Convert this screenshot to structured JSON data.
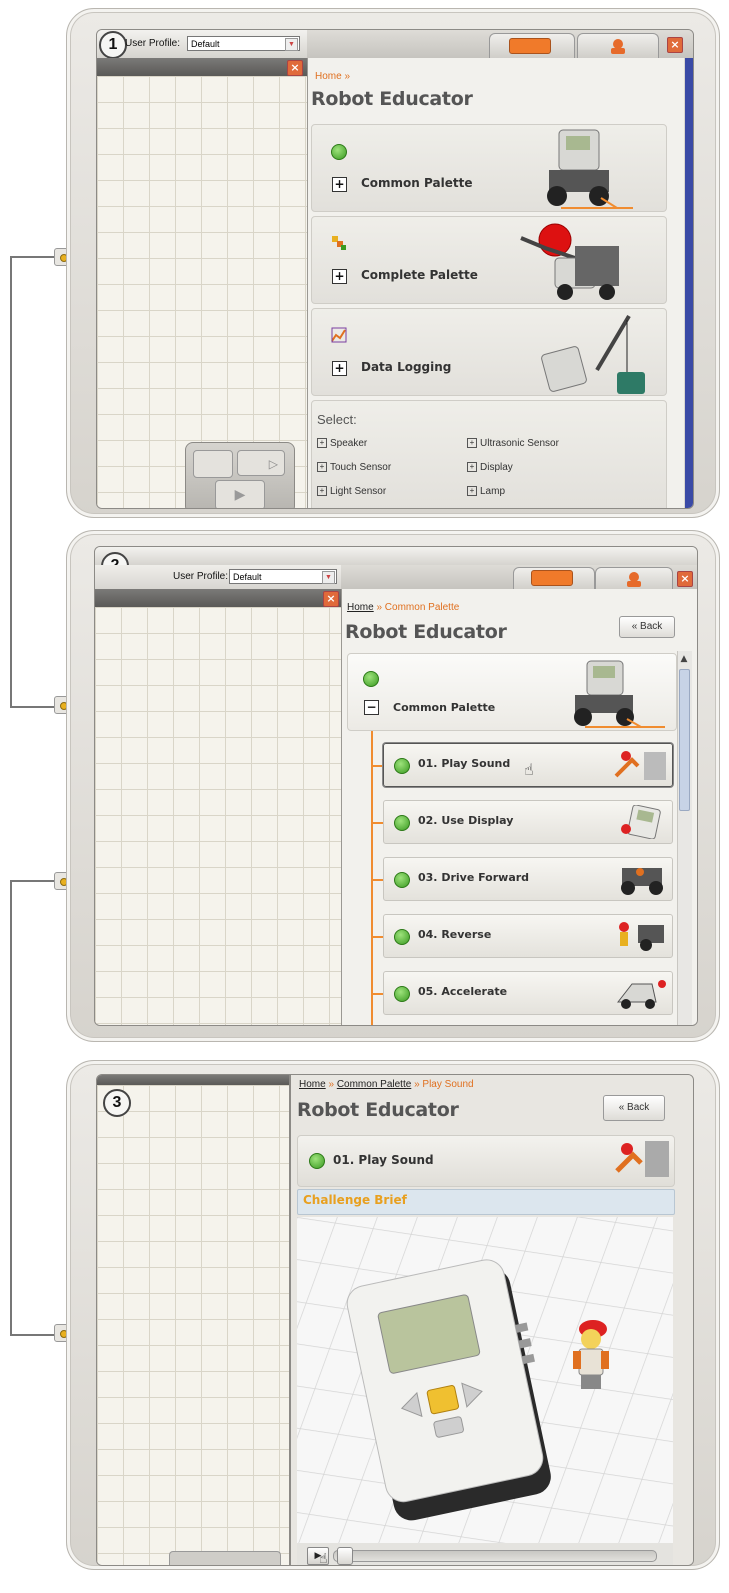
{
  "colors": {
    "accent_orange": "#e07020",
    "green_status": "#3a9a21",
    "challenge_bg": "#dce6ee"
  },
  "panel1": {
    "step": "1",
    "user_profile_label": "User Profile:",
    "user_profile_value": "Default",
    "breadcrumb_home": "Home »",
    "title": "Robot Educator",
    "cards": [
      {
        "label": "Common Palette",
        "icon": "green-dot-icon"
      },
      {
        "label": "Complete Palette",
        "icon": "complete-palette-icon"
      },
      {
        "label": "Data Logging",
        "icon": "data-logging-icon"
      }
    ],
    "select_label": "Select:",
    "select_items": [
      "Speaker",
      "Ultrasonic Sensor",
      "Touch Sensor",
      "Display",
      "Light Sensor",
      "Lamp"
    ]
  },
  "panel2": {
    "step": "2",
    "user_profile_label": "User Profile:",
    "user_profile_value": "Default",
    "breadcrumb_home": "Home",
    "breadcrumb_rest": "» Common Palette",
    "title": "Robot Educator",
    "back_label": "« Back",
    "section_label": "Common Palette",
    "lessons": [
      "01. Play Sound",
      "02. Use Display",
      "03. Drive Forward",
      "04. Reverse",
      "05. Accelerate"
    ]
  },
  "panel3": {
    "step": "3",
    "breadcrumb_home": "Home",
    "breadcrumb_mid": "Common Palette",
    "breadcrumb_rest": "» Play Sound",
    "title": "Robot Educator",
    "back_label": "« Back",
    "lesson_label": "01. Play Sound",
    "challenge_label": "Challenge Brief"
  }
}
